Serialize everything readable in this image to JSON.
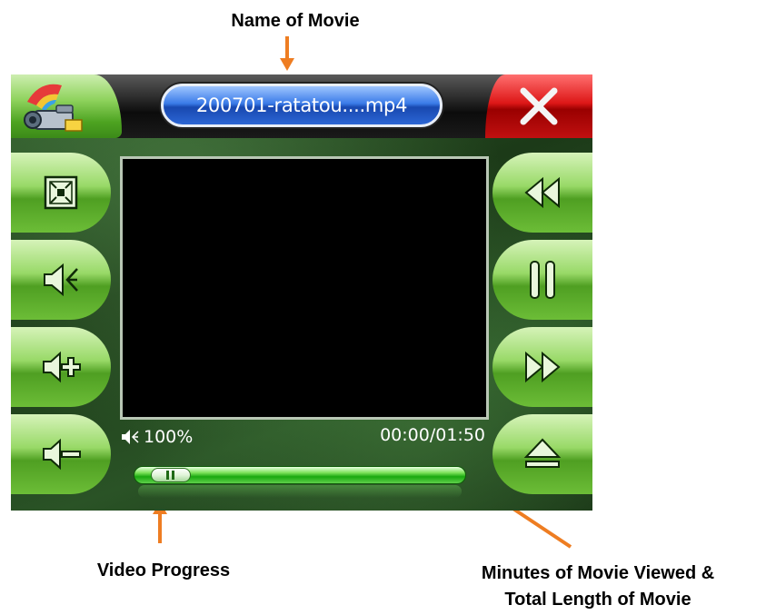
{
  "annotations": {
    "name_of_movie": "Name of Movie",
    "video_progress": "Video Progress",
    "minutes_viewed_line1": "Minutes of Movie Viewed &",
    "minutes_viewed_line2": "Total Length of Movie"
  },
  "player": {
    "title": "200701-ratatou....mp4",
    "volume": "100%",
    "time": "00:00/01:50",
    "progress_fraction": 0.05
  },
  "left_buttons": [
    {
      "icon": "fullscreen-icon"
    },
    {
      "icon": "mute-icon"
    },
    {
      "icon": "volume-up-icon"
    },
    {
      "icon": "volume-down-icon"
    }
  ],
  "right_buttons": [
    {
      "icon": "rewind-icon"
    },
    {
      "icon": "pause-icon"
    },
    {
      "icon": "fast-forward-icon"
    },
    {
      "icon": "eject-icon"
    }
  ],
  "colors": {
    "annotation_arrow": "#ee7d22",
    "accent_green": "#4da321",
    "title_pill_blue": "#2c66d4",
    "close_red": "#dd1717"
  }
}
